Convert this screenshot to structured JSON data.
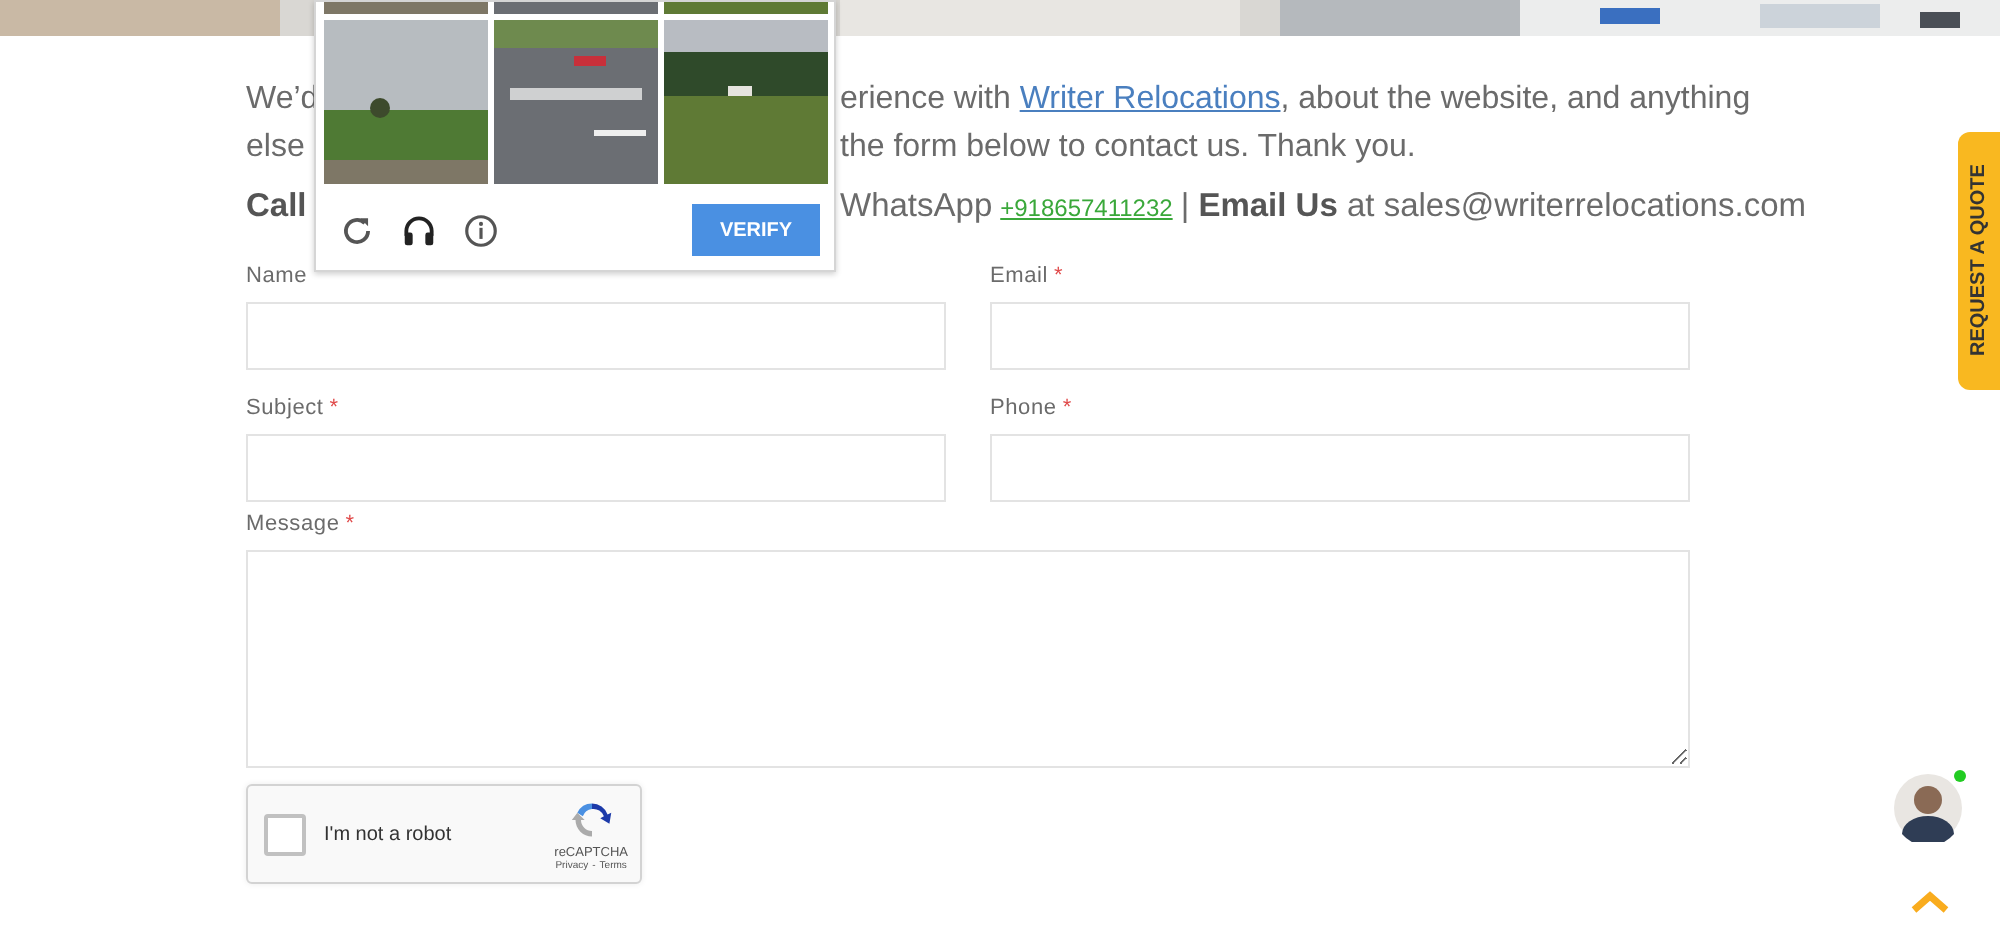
{
  "intro": {
    "line_1": {
      "left": "We’d",
      "before_link": "erience with",
      "link": "Writer Relocations",
      "after_link": ", about the website, and anything"
    },
    "line_2": {
      "left": "else",
      "right": "the form below to contact us. Thank you."
    },
    "line_3": {
      "left": "Call",
      "whatsapp_label": "WhatsApp",
      "phone": "+918657411232",
      "rest": "| **Email Us** at sales@writerrelocations.com"
    }
  },
  "captcha_challenge": {
    "verify_button": "VERIFY"
  },
  "form": {
    "fields": [
      {
        "label": "Name",
        "kind": "text"
      },
      {
        "label": "Email",
        "required_mark": "*",
        "kind": "text"
      },
      {
        "label": "Subject",
        "required_mark": "*",
        "kind": "text"
      },
      {
        "label": "Phone",
        "required_mark": "*",
        "kind": "text"
      },
      {
        "label": "Message",
        "required_mark": "*",
        "kind": "textarea"
      }
    ]
  },
  "recaptcha": {
    "checked": false,
    "label": "I'm not a robot",
    "brand": "reCAPTCHA",
    "privacy": "Privacy",
    "separator": "-",
    "terms": "Terms"
  },
  "side_tab": "REQUEST A QUOTE",
  "chat_avatar": {
    "online": true
  }
}
